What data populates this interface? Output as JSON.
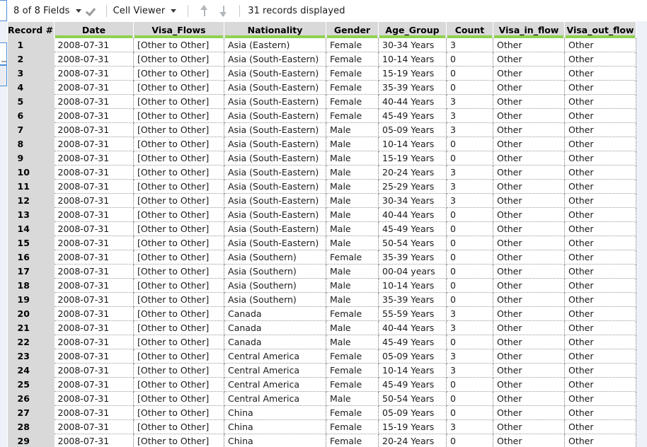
{
  "toolbar": {
    "fields_label": "8 of 8 Fields",
    "fields_caret": "chevron-down-icon",
    "check_icon": "check-icon",
    "viewer_label": "Cell Viewer",
    "viewer_caret": "chevron-down-icon",
    "up_icon": "arrow-up-icon",
    "down_icon": "arrow-down-icon",
    "records_count": "31",
    "records_suffix": "records displayed"
  },
  "table": {
    "columns": [
      "Record #",
      "Date",
      "Visa_Flows",
      "Nationality",
      "Gender",
      "Age_Group",
      "Count",
      "Visa_in_flow",
      "Visa_out_flow"
    ],
    "accent_color": "#8fd14f",
    "header_bg": "#d9d9d9",
    "rows": [
      [
        "1",
        "2008-07-31",
        "[Other to Other]",
        "Asia (Eastern)",
        "Female",
        "30-34 Years",
        "3",
        "Other",
        "Other"
      ],
      [
        "2",
        "2008-07-31",
        "[Other to Other]",
        "Asia (South-Eastern)",
        "Female",
        "10-14 Years",
        "0",
        "Other",
        "Other"
      ],
      [
        "3",
        "2008-07-31",
        "[Other to Other]",
        "Asia (South-Eastern)",
        "Female",
        "15-19 Years",
        "0",
        "Other",
        "Other"
      ],
      [
        "4",
        "2008-07-31",
        "[Other to Other]",
        "Asia (South-Eastern)",
        "Female",
        "35-39 Years",
        "0",
        "Other",
        "Other"
      ],
      [
        "5",
        "2008-07-31",
        "[Other to Other]",
        "Asia (South-Eastern)",
        "Female",
        "40-44 Years",
        "3",
        "Other",
        "Other"
      ],
      [
        "6",
        "2008-07-31",
        "[Other to Other]",
        "Asia (South-Eastern)",
        "Female",
        "45-49 Years",
        "3",
        "Other",
        "Other"
      ],
      [
        "7",
        "2008-07-31",
        "[Other to Other]",
        "Asia (South-Eastern)",
        "Male",
        "05-09 Years",
        "3",
        "Other",
        "Other"
      ],
      [
        "8",
        "2008-07-31",
        "[Other to Other]",
        "Asia (South-Eastern)",
        "Male",
        "10-14 Years",
        "0",
        "Other",
        "Other"
      ],
      [
        "9",
        "2008-07-31",
        "[Other to Other]",
        "Asia (South-Eastern)",
        "Male",
        "15-19 Years",
        "0",
        "Other",
        "Other"
      ],
      [
        "10",
        "2008-07-31",
        "[Other to Other]",
        "Asia (South-Eastern)",
        "Male",
        "20-24 Years",
        "3",
        "Other",
        "Other"
      ],
      [
        "11",
        "2008-07-31",
        "[Other to Other]",
        "Asia (South-Eastern)",
        "Male",
        "25-29 Years",
        "3",
        "Other",
        "Other"
      ],
      [
        "12",
        "2008-07-31",
        "[Other to Other]",
        "Asia (South-Eastern)",
        "Male",
        "30-34 Years",
        "3",
        "Other",
        "Other"
      ],
      [
        "13",
        "2008-07-31",
        "[Other to Other]",
        "Asia (South-Eastern)",
        "Male",
        "40-44 Years",
        "0",
        "Other",
        "Other"
      ],
      [
        "14",
        "2008-07-31",
        "[Other to Other]",
        "Asia (South-Eastern)",
        "Male",
        "45-49 Years",
        "0",
        "Other",
        "Other"
      ],
      [
        "15",
        "2008-07-31",
        "[Other to Other]",
        "Asia (South-Eastern)",
        "Male",
        "50-54 Years",
        "0",
        "Other",
        "Other"
      ],
      [
        "16",
        "2008-07-31",
        "[Other to Other]",
        "Asia (Southern)",
        "Female",
        "35-39 Years",
        "0",
        "Other",
        "Other"
      ],
      [
        "17",
        "2008-07-31",
        "[Other to Other]",
        "Asia (Southern)",
        "Male",
        "00-04 years",
        "0",
        "Other",
        "Other"
      ],
      [
        "18",
        "2008-07-31",
        "[Other to Other]",
        "Asia (Southern)",
        "Male",
        "10-14 Years",
        "0",
        "Other",
        "Other"
      ],
      [
        "19",
        "2008-07-31",
        "[Other to Other]",
        "Asia (Southern)",
        "Male",
        "35-39 Years",
        "0",
        "Other",
        "Other"
      ],
      [
        "20",
        "2008-07-31",
        "[Other to Other]",
        "Canada",
        "Female",
        "55-59 Years",
        "3",
        "Other",
        "Other"
      ],
      [
        "21",
        "2008-07-31",
        "[Other to Other]",
        "Canada",
        "Male",
        "40-44 Years",
        "3",
        "Other",
        "Other"
      ],
      [
        "22",
        "2008-07-31",
        "[Other to Other]",
        "Canada",
        "Male",
        "45-49 Years",
        "0",
        "Other",
        "Other"
      ],
      [
        "23",
        "2008-07-31",
        "[Other to Other]",
        "Central America",
        "Female",
        "05-09 Years",
        "3",
        "Other",
        "Other"
      ],
      [
        "24",
        "2008-07-31",
        "[Other to Other]",
        "Central America",
        "Female",
        "10-14 Years",
        "3",
        "Other",
        "Other"
      ],
      [
        "25",
        "2008-07-31",
        "[Other to Other]",
        "Central America",
        "Female",
        "45-49 Years",
        "0",
        "Other",
        "Other"
      ],
      [
        "26",
        "2008-07-31",
        "[Other to Other]",
        "Central America",
        "Male",
        "50-54 Years",
        "0",
        "Other",
        "Other"
      ],
      [
        "27",
        "2008-07-31",
        "[Other to Other]",
        "China",
        "Female",
        "05-09 Years",
        "0",
        "Other",
        "Other"
      ],
      [
        "28",
        "2008-07-31",
        "[Other to Other]",
        "China",
        "Female",
        "15-19 Years",
        "3",
        "Other",
        "Other"
      ],
      [
        "29",
        "2008-07-31",
        "[Other to Other]",
        "China",
        "Female",
        "20-24 Years",
        "0",
        "Other",
        "Other"
      ]
    ]
  }
}
